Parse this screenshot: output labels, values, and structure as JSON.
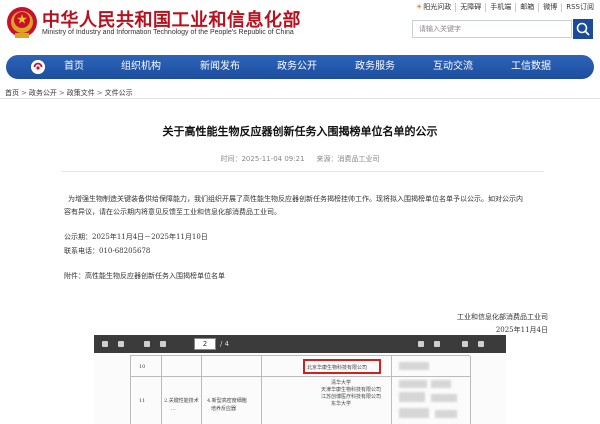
{
  "header": {
    "title": "中华人民共和国工业和信息化部",
    "subtitle": "Ministry of Industry and Information Technology of the People's Republic of China",
    "top_links": [
      "阳光问政",
      "无障碍",
      "手机端",
      "邮箱",
      "微博",
      "RSS订阅"
    ],
    "search_placeholder": "请输入关键字"
  },
  "nav": {
    "items": [
      "首页",
      "组织机构",
      "新闻发布",
      "政务公开",
      "政务服务",
      "互动交流",
      "工信数据"
    ]
  },
  "breadcrumb": [
    "首页",
    "政务公开",
    "政策文件",
    "文件公示"
  ],
  "article": {
    "title": "关于高性能生物反应器创新任务入围揭榜单位名单的公示",
    "time_label": "时间：2025-11-04 09:21",
    "source_label": "来源：消费品工业司",
    "para1": "为增强生物制造关键装备供给保障能力，我们组织开展了高性能生物反应器创新任务揭榜挂帅工作。现将拟入围揭榜单位名单予以公示。如对公示内",
    "para1b": "容有异议，请在公示期内将意见反馈至工业和信息化部消费品工业司。",
    "date_range": "公示期：2025年11月4日－2025年11月10日",
    "phone": "联系电话：010-68205678",
    "attachment": "附件：高性能生物反应器创新任务入围揭榜单位名单",
    "sign_org": "工业和信息化部消费品工业司",
    "sign_date": "2025年11月4日"
  },
  "pdf": {
    "page_current": "2",
    "page_total": "/ 4",
    "rows": [
      {
        "no": "10",
        "task": "",
        "org_highlight": "北京华康生物科技有限公司"
      },
      {
        "no": "11",
        "task": "2.关键性能技术",
        "task2": "...",
        "direction": "4.新型高密度细胞",
        "direction2": "培养反应器",
        "orgs": [
          "清华大学",
          "天津华康生物科技有限公司",
          "江苏创博医疗科技有限公司",
          "东华大学"
        ]
      }
    ]
  }
}
